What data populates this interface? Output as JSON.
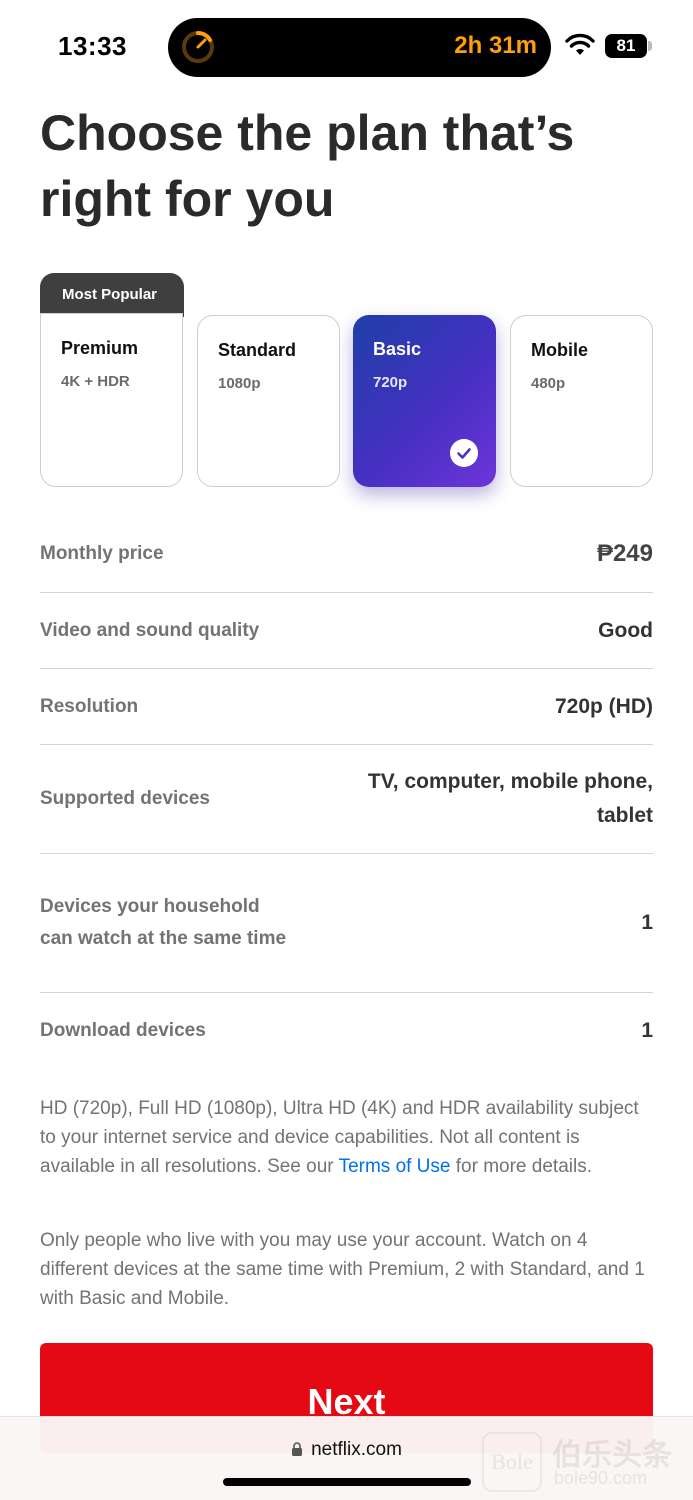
{
  "status_bar": {
    "time": "13:33",
    "timer": "2h 31m",
    "battery": "81"
  },
  "page": {
    "title": "Choose the plan that’s right for you"
  },
  "plans": {
    "popular_tag": "Most Popular",
    "selected": "Basic",
    "items": [
      {
        "name": "Premium",
        "resolution": "4K + HDR"
      },
      {
        "name": "Standard",
        "resolution": "1080p"
      },
      {
        "name": "Basic",
        "resolution": "720p"
      },
      {
        "name": "Mobile",
        "resolution": "480p"
      }
    ]
  },
  "details": [
    {
      "label": "Monthly price",
      "value": "₱249"
    },
    {
      "label": "Video and sound quality",
      "value": "Good"
    },
    {
      "label": "Resolution",
      "value": "720p (HD)"
    },
    {
      "label": "Supported devices",
      "value": "TV, computer, mobile phone, tablet"
    },
    {
      "label": "Devices your household can watch at the same time",
      "value": "1"
    },
    {
      "label": "Download devices",
      "value": "1"
    }
  ],
  "notes": {
    "availability_before": "HD (720p), Full HD (1080p), Ultra HD (4K) and HDR availability subject to your internet service and device capabilities. Not all content is available in all resolutions. See our ",
    "terms_link": "Terms of Use",
    "availability_after": " for more details.",
    "household": "Only people who live with you may use your account. Watch on 4 different devices at the same time with Premium, 2 with Standard, and 1 with Basic and Mobile."
  },
  "next_button": "Next",
  "browser": {
    "url": "netflix.com"
  },
  "watermark": {
    "logo": "Bole",
    "text": "伯乐头条",
    "sub": "bole90.com"
  },
  "colors": {
    "accent_red": "#e50914",
    "link_blue": "#0071eb",
    "timer_orange": "#ff9f0a",
    "selected_gradient_start": "#1f3fa8",
    "selected_gradient_end": "#6d35d8"
  },
  "icons": [
    "timer-icon",
    "wifi-icon",
    "battery-icon",
    "checkmark-icon",
    "lock-icon"
  ]
}
